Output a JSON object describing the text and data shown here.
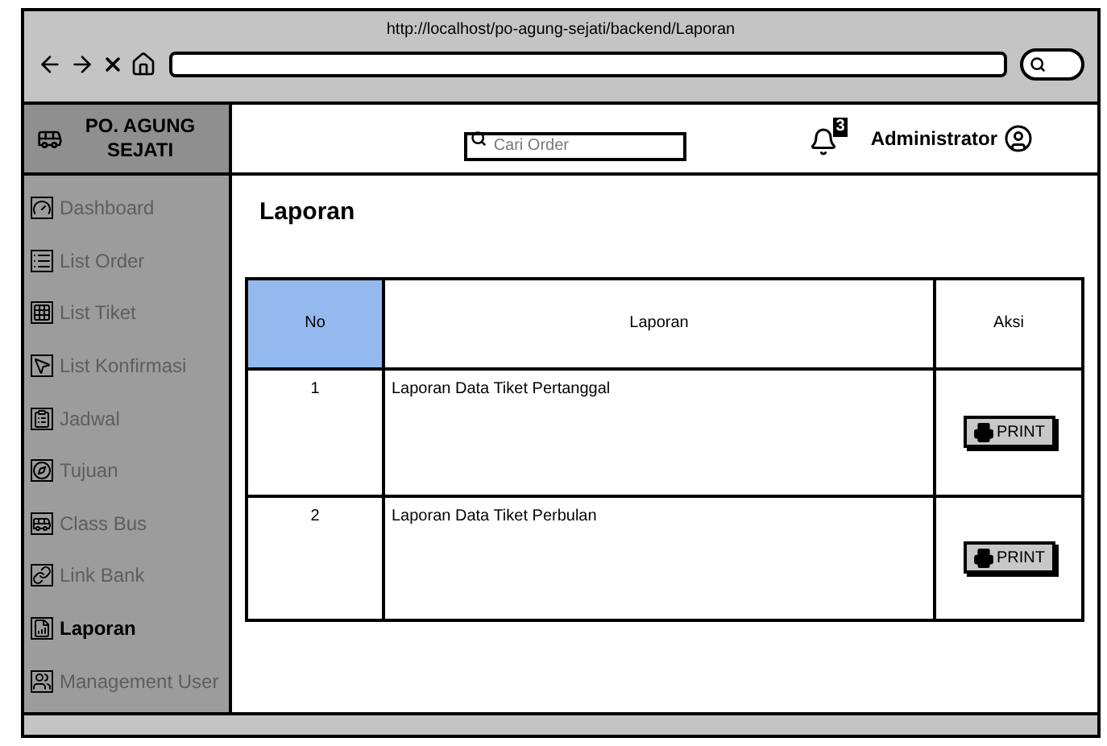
{
  "browser": {
    "url": "http://localhost/po-agung-sejati/backend/Laporan"
  },
  "brand": {
    "name": "PO. AGUNG SEJATI"
  },
  "header": {
    "search": {
      "placeholder": "Cari Order"
    },
    "notifications": {
      "count": "3"
    },
    "user": "Administrator"
  },
  "sidebar": {
    "items": [
      {
        "label": "Dashboard",
        "selected": false
      },
      {
        "label": "List Order",
        "selected": false
      },
      {
        "label": "List Tiket",
        "selected": false
      },
      {
        "label": "List Konfirmasi",
        "selected": false
      },
      {
        "label": "Jadwal",
        "selected": false
      },
      {
        "label": "Tujuan",
        "selected": false
      },
      {
        "label": "Class Bus",
        "selected": false
      },
      {
        "label": "Link Bank",
        "selected": false
      },
      {
        "label": "Laporan",
        "selected": true
      },
      {
        "label": "Management User",
        "selected": false
      }
    ]
  },
  "page": {
    "title": "Laporan"
  },
  "table": {
    "columns": [
      {
        "label": "No",
        "selected": true
      },
      {
        "label": "Laporan",
        "selected": false
      },
      {
        "label": "Aksi",
        "selected": false
      }
    ],
    "rows": [
      {
        "no": "1",
        "laporan": "Laporan Data Tiket Pertanggal",
        "action": "PRINT"
      },
      {
        "no": "2",
        "laporan": "Laporan Data Tiket Perbulan",
        "action": "PRINT"
      }
    ]
  }
}
